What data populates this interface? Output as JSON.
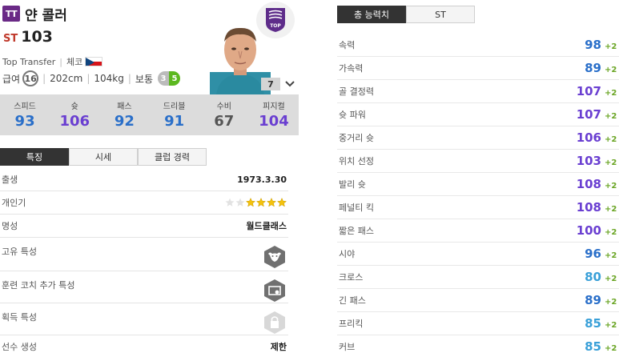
{
  "player": {
    "season_badge": "TT",
    "name": "얀 콜러",
    "position": "ST",
    "overall": "103",
    "season": "Top Transfer",
    "nation": "체코",
    "salary_label": "급여",
    "salary": "16",
    "height": "202cm",
    "weight": "104kg",
    "body_type": "보통",
    "weak_foot": "3",
    "skill_moves": "5",
    "level": "7"
  },
  "club": {
    "logo_text": "TOP"
  },
  "stats": [
    {
      "label": "스피드",
      "value": "93",
      "color": "#2a6fc9"
    },
    {
      "label": "슛",
      "value": "106",
      "color": "#6a3fd1"
    },
    {
      "label": "패스",
      "value": "92",
      "color": "#2a6fc9"
    },
    {
      "label": "드리블",
      "value": "91",
      "color": "#2a6fc9"
    },
    {
      "label": "수비",
      "value": "67",
      "color": "#555555"
    },
    {
      "label": "피지컬",
      "value": "104",
      "color": "#6a3fd1"
    }
  ],
  "tabs": [
    "특징",
    "시세",
    "클럽 경력"
  ],
  "details": {
    "birth_label": "출생",
    "birth": "1973.3.30",
    "popularity_label": "개인기",
    "popularity_stars": 4,
    "popularity_max": 6,
    "reputation_label": "명성",
    "reputation": "월드클래스",
    "unique_trait_label": "고유 특성",
    "coach_trait_label": "훈련 코치 추가 특성",
    "acquired_trait_label": "획득 특성",
    "generation_label": "선수 생성",
    "generation": "제한"
  },
  "right_tabs": [
    "총 능력치",
    "ST"
  ],
  "attributes": [
    {
      "name": "속력",
      "value": "98",
      "bonus": "+2",
      "color": "#2a6fc9"
    },
    {
      "name": "가속력",
      "value": "89",
      "bonus": "+2",
      "color": "#2a6fc9"
    },
    {
      "name": "골 결정력",
      "value": "107",
      "bonus": "+2",
      "color": "#6a3fd1"
    },
    {
      "name": "슛 파워",
      "value": "107",
      "bonus": "+2",
      "color": "#6a3fd1"
    },
    {
      "name": "중거리 슛",
      "value": "106",
      "bonus": "+2",
      "color": "#6a3fd1"
    },
    {
      "name": "위치 선정",
      "value": "103",
      "bonus": "+2",
      "color": "#6a3fd1"
    },
    {
      "name": "발리 슛",
      "value": "108",
      "bonus": "+2",
      "color": "#6a3fd1"
    },
    {
      "name": "페널티 킥",
      "value": "108",
      "bonus": "+2",
      "color": "#6a3fd1"
    },
    {
      "name": "짧은 패스",
      "value": "100",
      "bonus": "+2",
      "color": "#6a3fd1"
    },
    {
      "name": "시야",
      "value": "96",
      "bonus": "+2",
      "color": "#2a6fc9"
    },
    {
      "name": "크로스",
      "value": "80",
      "bonus": "+2",
      "color": "#3aa0d8"
    },
    {
      "name": "긴 패스",
      "value": "89",
      "bonus": "+2",
      "color": "#2a6fc9"
    },
    {
      "name": "프리킥",
      "value": "85",
      "bonus": "+2",
      "color": "#3aa0d8"
    },
    {
      "name": "커브",
      "value": "85",
      "bonus": "+2",
      "color": "#3aa0d8"
    }
  ]
}
